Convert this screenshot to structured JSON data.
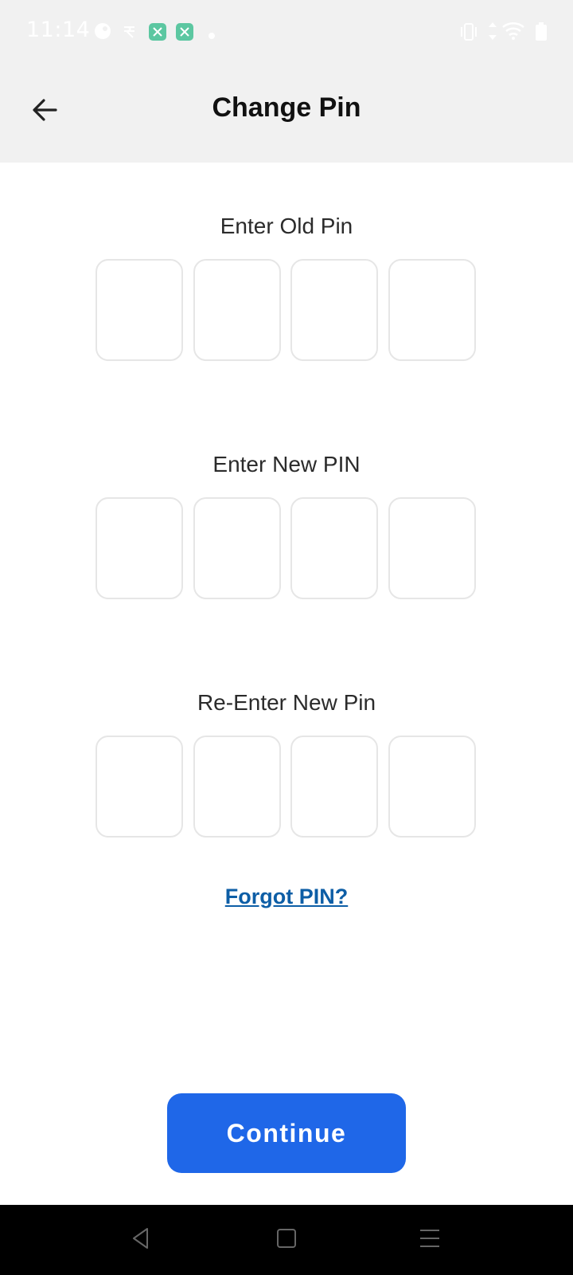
{
  "status_bar": {
    "time": "11:14",
    "icons": [
      "cloud-icon",
      "rupee-icon",
      "app-icon",
      "app-icon",
      "dot-icon",
      "vibrate-icon",
      "data-arrows-icon",
      "wifi-icon",
      "battery-icon"
    ]
  },
  "header": {
    "title": "Change Pin",
    "back_icon": "arrow-left-icon"
  },
  "sections": [
    {
      "label": "Enter Old Pin",
      "digits": [
        "",
        "",
        "",
        ""
      ]
    },
    {
      "label": "Enter New PIN",
      "digits": [
        "",
        "",
        "",
        ""
      ]
    },
    {
      "label": "Re-Enter New Pin",
      "digits": [
        "",
        "",
        "",
        ""
      ]
    }
  ],
  "forgot_link": "Forgot PIN?",
  "continue_button": "Continue",
  "colors": {
    "header_bg": "#f1f1f1",
    "primary_button": "#1f67e8",
    "link": "#0d5ea6",
    "pin_border": "#e6e6e6"
  },
  "nav_bar": {
    "icons": [
      "back-triangle-icon",
      "home-square-icon",
      "menu-lines-icon"
    ]
  }
}
